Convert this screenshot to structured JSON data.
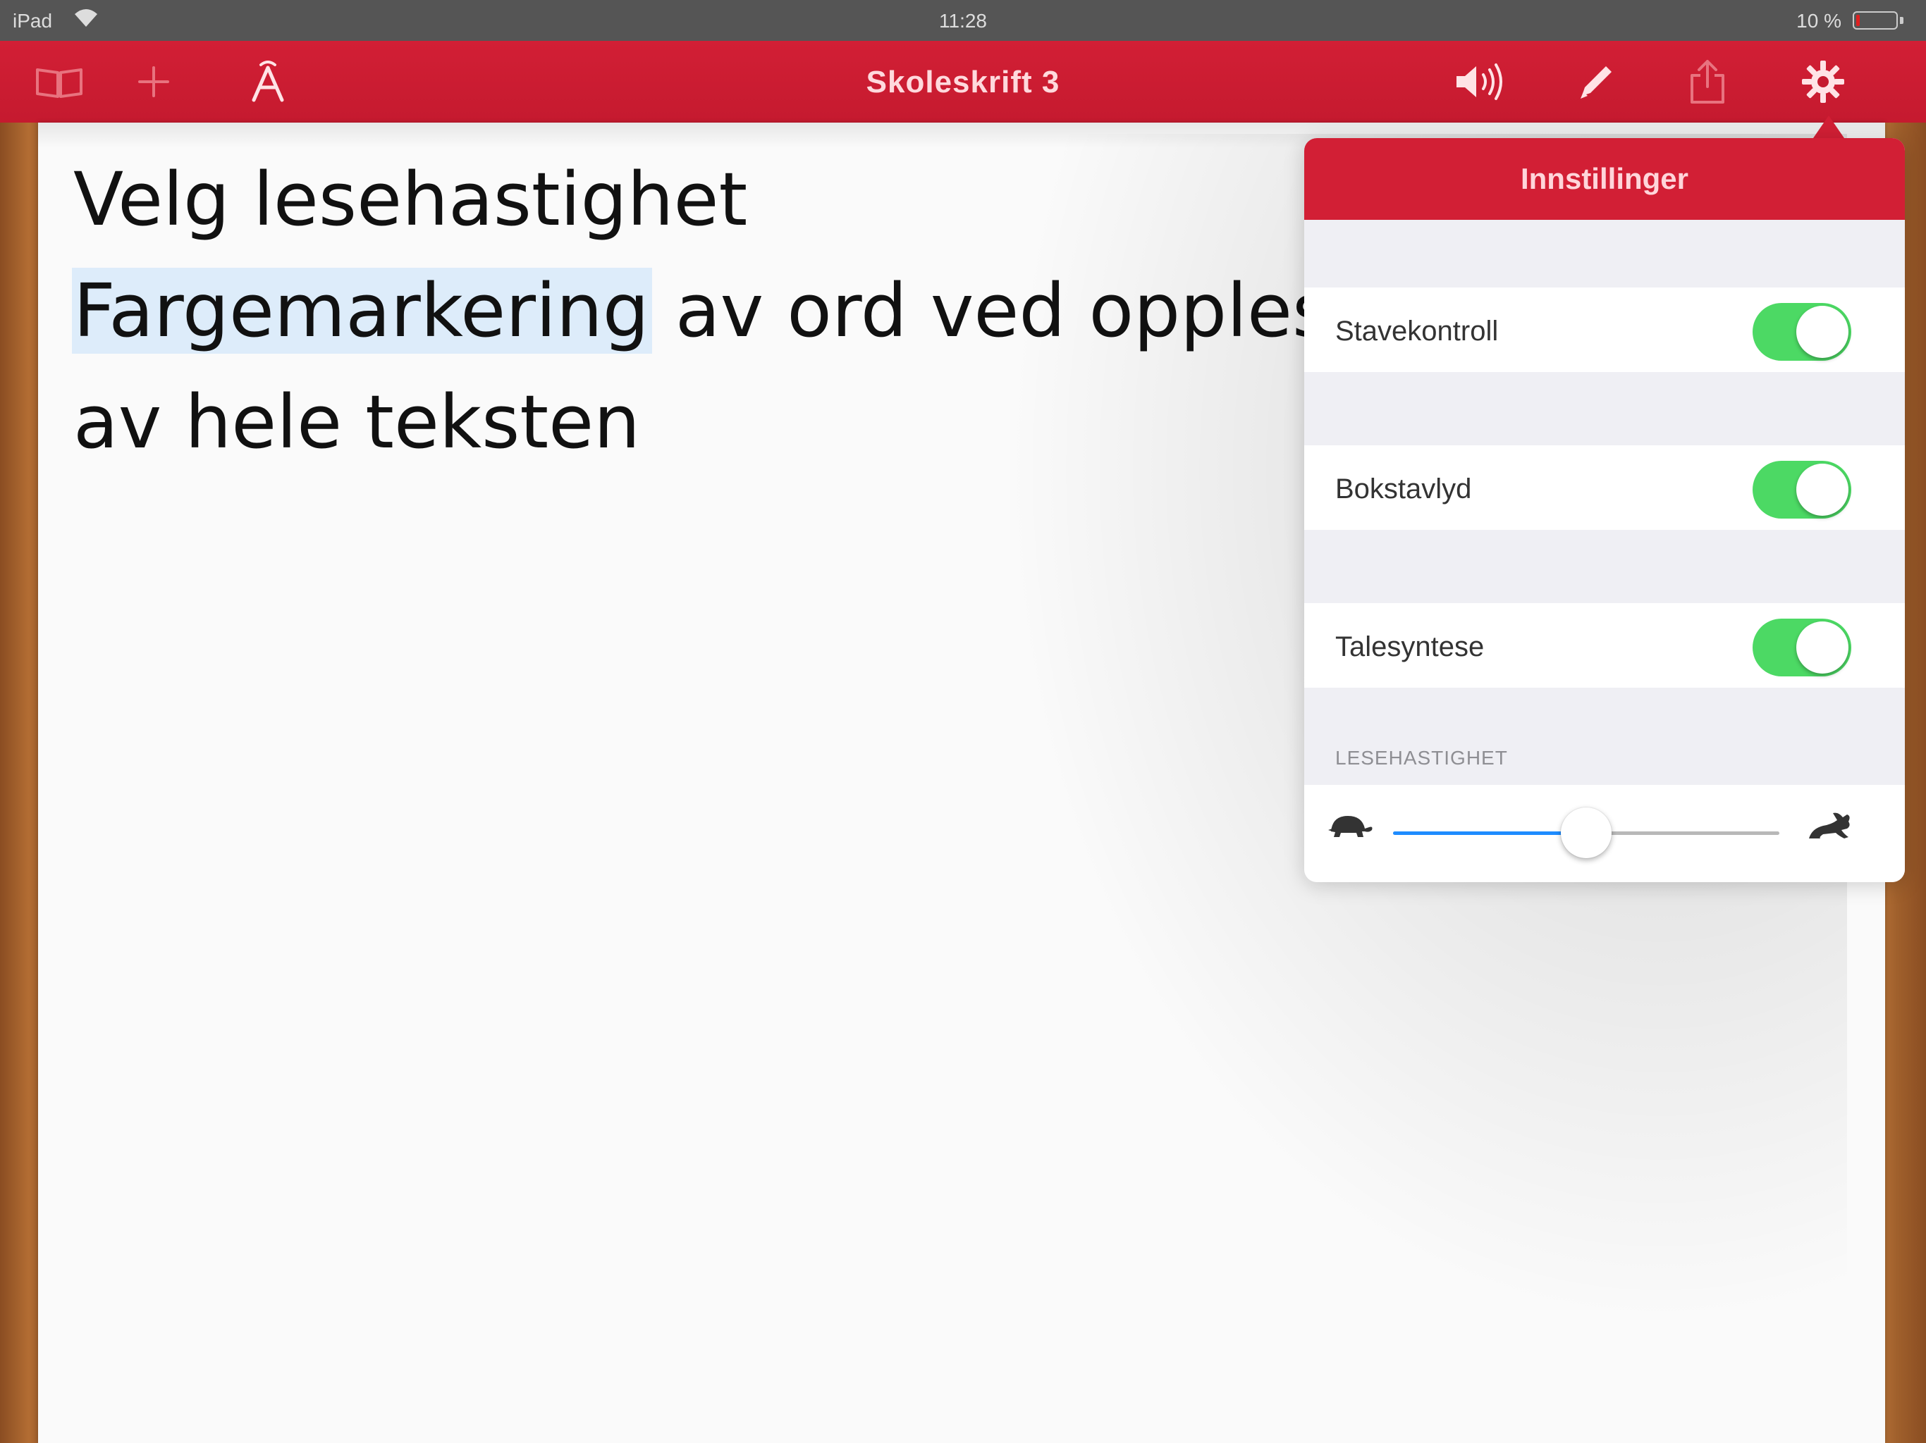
{
  "status_bar": {
    "device": "iPad",
    "time": "11:28",
    "battery_text": "10 %",
    "battery_level": 0.1
  },
  "toolbar": {
    "title": "Skoleskrift 3",
    "icons": {
      "book": "book-icon",
      "add": "plus-icon",
      "font": "font-icon",
      "speaker": "speaker-icon",
      "pen": "pen-icon",
      "share": "share-icon",
      "settings": "gear-icon"
    },
    "accent_color": "#d21f35"
  },
  "document": {
    "lines": [
      "Velg lesehastighet",
      "Fargemarkering",
      " av ord ved opplesning",
      "av hele teksten"
    ],
    "highlight_color": "#ddecfa"
  },
  "settings_popover": {
    "title": "Innstillinger",
    "toggles": [
      {
        "label": "Stavekontroll",
        "on": true
      },
      {
        "label": "Bokstavlyd",
        "on": true
      },
      {
        "label": "Talesyntese",
        "on": true
      }
    ],
    "toggle_on_color": "#4cd964",
    "speed": {
      "section_label": "LESEHASTIGHET",
      "value": 0.5,
      "min_icon": "turtle-icon",
      "max_icon": "hare-icon"
    }
  }
}
